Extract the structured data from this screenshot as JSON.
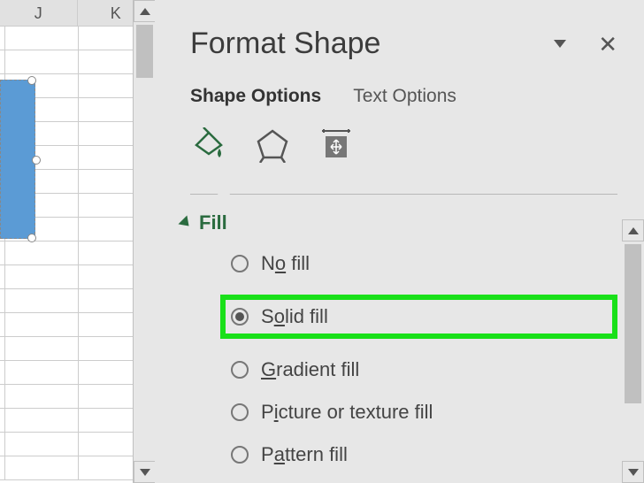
{
  "sheet": {
    "columns": [
      "J",
      "K"
    ]
  },
  "panel": {
    "title": "Format Shape",
    "tabs": {
      "shape": "Shape Options",
      "text": "Text Options"
    },
    "section": "Fill",
    "options": {
      "no_fill_pre": "N",
      "no_fill_u": "o",
      "no_fill_post": " fill",
      "solid_pre": "S",
      "solid_u": "o",
      "solid_post": "lid fill",
      "gradient_u": "G",
      "gradient_post": "radient fill",
      "picture_pre": "P",
      "picture_u": "i",
      "picture_post": "cture or texture fill",
      "pattern_pre": "P",
      "pattern_u": "a",
      "pattern_post": "ttern fill"
    }
  }
}
